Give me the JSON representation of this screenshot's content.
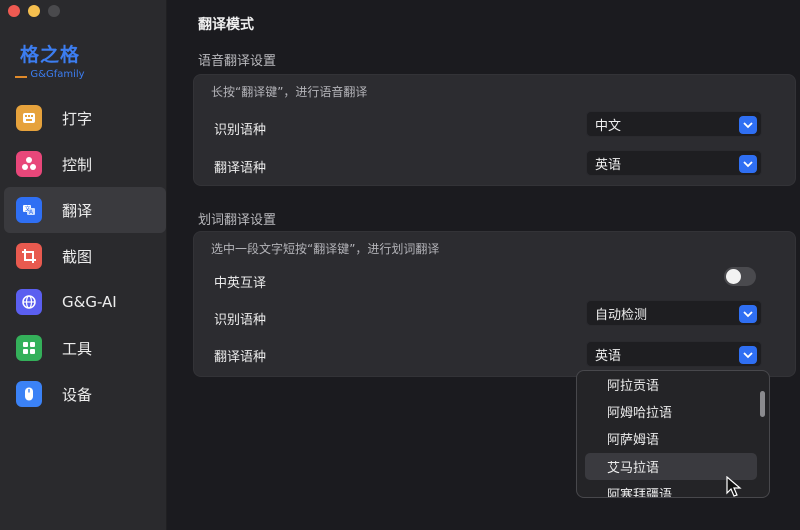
{
  "window": {
    "controls": [
      "close",
      "minimize",
      "zoom"
    ]
  },
  "logo": {
    "name_cn": "格之格",
    "name_en": "G&Gfamily"
  },
  "sidebar": {
    "items": [
      {
        "label": "打字",
        "icon": "typing-icon",
        "color": "#e6a23c",
        "active": false
      },
      {
        "label": "控制",
        "icon": "fan-control-icon",
        "color": "#e8477a",
        "active": false
      },
      {
        "label": "翻译",
        "icon": "translate-icon",
        "color": "#2f6ff3",
        "active": true
      },
      {
        "label": "截图",
        "icon": "crop-icon",
        "color": "#e85a4f",
        "active": false
      },
      {
        "label": "G&G-AI",
        "icon": "globe-icon",
        "color": "#5b5ff0",
        "active": false
      },
      {
        "label": "工具",
        "icon": "tools-grid-icon",
        "color": "#34b05a",
        "active": false
      },
      {
        "label": "设备",
        "icon": "mouse-icon",
        "color": "#3b82f6",
        "active": false
      }
    ]
  },
  "main": {
    "title": "翻译模式",
    "voice_section": {
      "title": "语音翻译设置",
      "description": "长按“翻译键”，进行语音翻译",
      "rows": [
        {
          "label": "识别语种",
          "value": "中文"
        },
        {
          "label": "翻译语种",
          "value": "英语"
        }
      ]
    },
    "word_section": {
      "title": "划词翻译设置",
      "description": "选中一段文字短按“翻译键”，进行划词翻译",
      "toggle": {
        "label": "中英互译",
        "on": false
      },
      "rows": [
        {
          "label": "识别语种",
          "value": "自动检测"
        },
        {
          "label": "翻译语种",
          "value": "英语"
        }
      ]
    }
  },
  "dropdown": {
    "options": [
      "阿拉贡语",
      "阿姆哈拉语",
      "阿萨姆语",
      "艾马拉语",
      "阿塞拜疆语"
    ],
    "highlighted": "艾马拉语"
  },
  "colors": {
    "accent": "#2f6ff3",
    "background": "#1b1b1f",
    "panel": "#2c2c30",
    "sidebar": "#2a2a2d"
  }
}
